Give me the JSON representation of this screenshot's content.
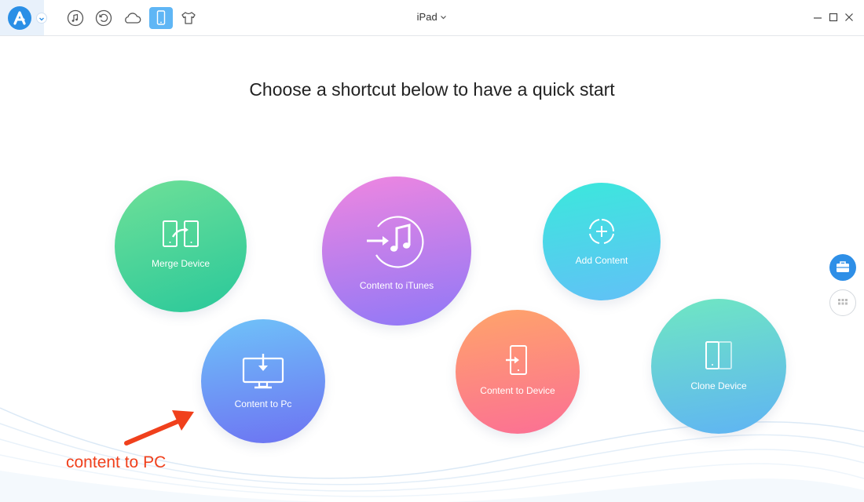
{
  "titlebar": {
    "device_name": "iPad",
    "toolbar_icons": [
      "music-icon",
      "restore-icon",
      "cloud-icon",
      "device-icon",
      "shirt-icon"
    ],
    "active_icon": "device-icon",
    "window_controls": [
      "minimize-icon",
      "maximize-icon",
      "close-icon"
    ]
  },
  "main": {
    "heading": "Choose a shortcut below to have a quick start",
    "shortcuts": [
      {
        "label": "Merge Device",
        "icon": "merge-device-icon"
      },
      {
        "label": "Content to iTunes",
        "icon": "itunes-icon"
      },
      {
        "label": "Add Content",
        "icon": "add-content-icon"
      },
      {
        "label": "Content to Pc",
        "icon": "content-to-pc-icon"
      },
      {
        "label": "Content to Device",
        "icon": "content-to-device-icon"
      },
      {
        "label": "Clone Device",
        "icon": "clone-device-icon"
      }
    ]
  },
  "sidebar": {
    "buttons": [
      "toolbox-icon",
      "apps-grid-icon"
    ]
  },
  "annotation": {
    "text": "content to PC"
  },
  "colors": {
    "accent": "#2e8fe7",
    "annotation": "#f0401c"
  }
}
